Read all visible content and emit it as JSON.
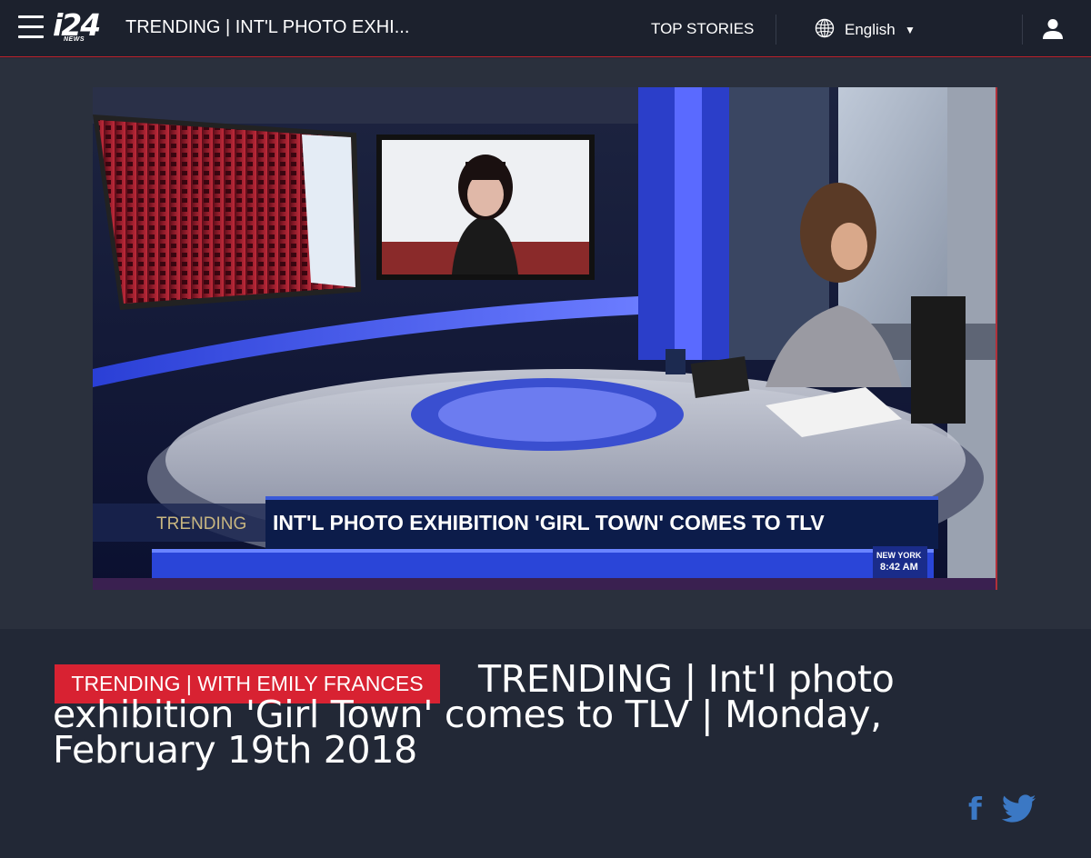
{
  "header": {
    "logo_text": "i24",
    "logo_subtext": "NEWS",
    "title": "TRENDING | INT'L PHOTO EXHI...",
    "top_stories_label": "TOP STORIES",
    "language_label": "English",
    "language_caret": "▼",
    "icons": [
      "menu-icon",
      "globe-icon",
      "user-icon"
    ]
  },
  "video": {
    "lower_third_tag": "TRENDING",
    "lower_third_headline": "INT'L PHOTO EXHIBITION 'GIRL TOWN' COMES TO TLV",
    "location_label": "NEW YORK",
    "time_label": "8:42 AM"
  },
  "article": {
    "category_label": "TRENDING | WITH EMILY FRANCES",
    "title": "TRENDING | Int'l photo exhibition 'Girl Town' comes to TLV | Monday, February 19th 2018"
  },
  "social": {
    "facebook_glyph": "f",
    "icons": [
      "facebook-icon",
      "twitter-icon"
    ]
  },
  "colors": {
    "accent": "#d82232",
    "header_bg": "#1c212d",
    "page_bg": "#222836",
    "video_section_bg": "#2a303d",
    "social_blue": "#3b78c4"
  }
}
